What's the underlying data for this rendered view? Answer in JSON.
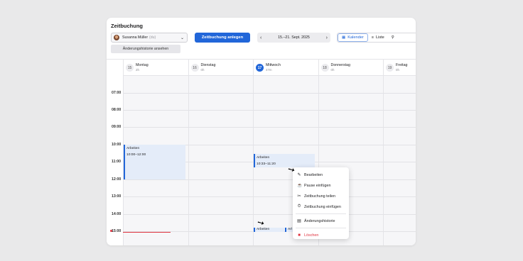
{
  "title": "Zeitbuchung",
  "user_select": {
    "name": "Susanna Müller",
    "sub": "(du)"
  },
  "primary_button": "Zeitbuchung anlegen",
  "date_nav": {
    "range": "15.–21. Sept. 2025"
  },
  "views": {
    "calendar": "Kalender",
    "list": "Liste"
  },
  "history_button": "Änderungshistorie ansehen",
  "days": [
    {
      "num": "15",
      "name": "Montag",
      "hours": "2h"
    },
    {
      "num": "16",
      "name": "Dienstag",
      "hours": "0h"
    },
    {
      "num": "17",
      "name": "Mittwoch",
      "hours": "47m"
    },
    {
      "num": "18",
      "name": "Donnerstag",
      "hours": "0h"
    },
    {
      "num": "19",
      "name": "Freitag",
      "hours": "0h"
    }
  ],
  "hours": [
    "07:00",
    "08:00",
    "09:00",
    "10:00",
    "11:00",
    "12:00",
    "13:00",
    "14:00",
    "15:00"
  ],
  "events": {
    "monday": {
      "label": "Arbeiten",
      "time": "10:00–12:00"
    },
    "wednesday": {
      "label": "Arbeiten",
      "time": "10:33–11:20"
    },
    "wednesday_small": {
      "label": "Arbeiten",
      "label2": "Arl"
    }
  },
  "context_menu": {
    "edit": "Bearbeiten",
    "pause": "Pause einfügen",
    "split": "Zeitbuchung teilen",
    "insert": "Zeitbuchung einfügen",
    "history": "Änderungshistorie",
    "delete": "Löschen"
  },
  "colors": {
    "accent": "#2166d9",
    "danger": "#e0333f",
    "event_bg": "#e4ecf9"
  }
}
